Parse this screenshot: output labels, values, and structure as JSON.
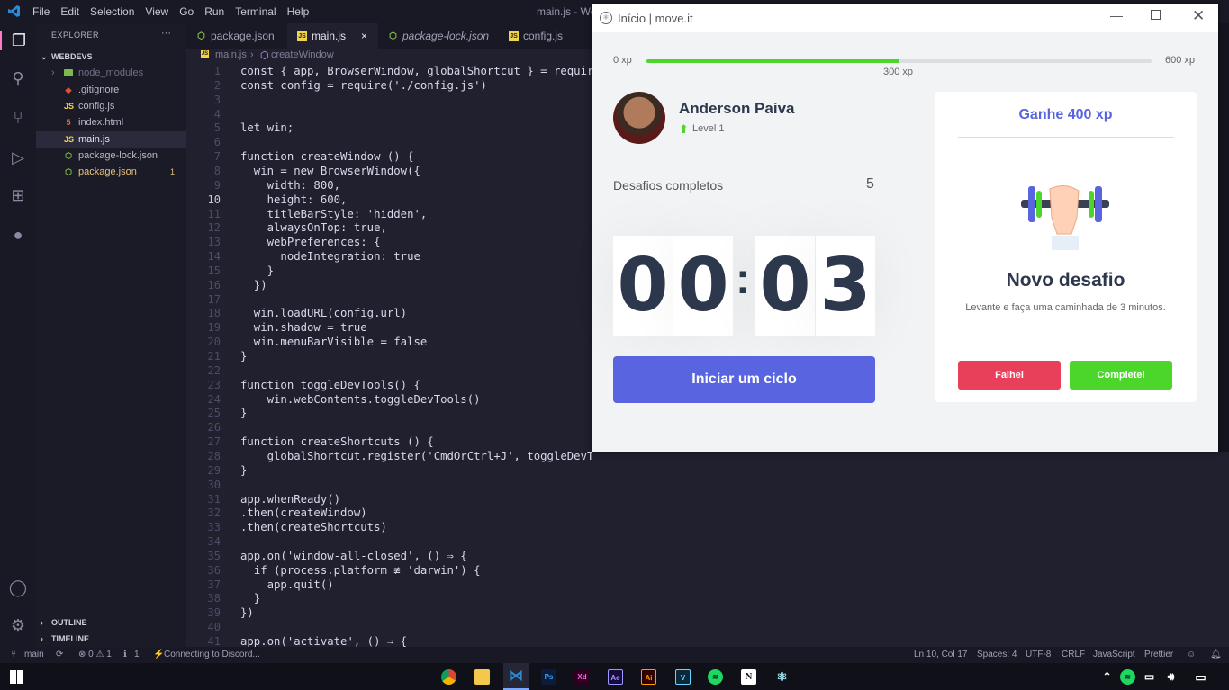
{
  "vscode": {
    "menu": [
      "File",
      "Edit",
      "Selection",
      "View",
      "Go",
      "Run",
      "Terminal",
      "Help"
    ],
    "window_title": "main.js - Web",
    "explorer_header": "EXPLORER",
    "explorer_more": "···",
    "project": "WEBDEVS",
    "files": [
      {
        "name": "node_modules",
        "kind": "folder"
      },
      {
        "name": ".gitignore",
        "kind": "git"
      },
      {
        "name": "config.js",
        "kind": "js"
      },
      {
        "name": "index.html",
        "kind": "html"
      },
      {
        "name": "main.js",
        "kind": "js"
      },
      {
        "name": "package-lock.json",
        "kind": "json"
      },
      {
        "name": "package.json",
        "kind": "json",
        "badge": "1"
      }
    ],
    "outline": "OUTLINE",
    "timeline": "TIMELINE",
    "tabs": [
      {
        "label": "package.json",
        "kind": "json"
      },
      {
        "label": "main.js",
        "kind": "js",
        "active": true,
        "close": "×"
      },
      {
        "label": "package-lock.json",
        "kind": "json"
      },
      {
        "label": "config.js",
        "kind": "js"
      }
    ],
    "breadcrumb": [
      "main.js",
      "createWindow"
    ],
    "status": {
      "branch": "main",
      "problems": "⊗ 0 ⚠ 1",
      "info": "1",
      "discord": "Connecting to Discord...",
      "position": "Ln 10, Col 17",
      "spaces": "Spaces: 4",
      "encoding": "UTF-8",
      "eol": "CRLF",
      "language": "JavaScript",
      "formatter": "Prettier"
    },
    "code": [
      {
        "n": "1",
        "t": "const { app, BrowserWindow, globalShortcut } = require('electron')"
      },
      {
        "n": "2",
        "t": "const config = require('./config.js')"
      },
      {
        "n": "3",
        "t": ""
      },
      {
        "n": "4",
        "t": ""
      },
      {
        "n": "5",
        "t": "let win;"
      },
      {
        "n": "6",
        "t": ""
      },
      {
        "n": "7",
        "t": "function createWindow () {"
      },
      {
        "n": "8",
        "t": "  win = new BrowserWindow({"
      },
      {
        "n": "9",
        "t": "    width: 800,"
      },
      {
        "n": "10",
        "t": "    height: 600,"
      },
      {
        "n": "11",
        "t": "    titleBarStyle: 'hidden',"
      },
      {
        "n": "12",
        "t": "    alwaysOnTop: true,"
      },
      {
        "n": "13",
        "t": "    webPreferences: {"
      },
      {
        "n": "14",
        "t": "      nodeIntegration: true"
      },
      {
        "n": "15",
        "t": "    }"
      },
      {
        "n": "16",
        "t": "  })"
      },
      {
        "n": "17",
        "t": ""
      },
      {
        "n": "18",
        "t": "  win.loadURL(config.url)"
      },
      {
        "n": "19",
        "t": "  win.shadow = true"
      },
      {
        "n": "20",
        "t": "  win.menuBarVisible = false"
      },
      {
        "n": "21",
        "t": "}"
      },
      {
        "n": "22",
        "t": ""
      },
      {
        "n": "23",
        "t": "function toggleDevTools() {"
      },
      {
        "n": "24",
        "t": "    win.webContents.toggleDevTools()"
      },
      {
        "n": "25",
        "t": "}"
      },
      {
        "n": "26",
        "t": ""
      },
      {
        "n": "27",
        "t": "function createShortcuts () {"
      },
      {
        "n": "28",
        "t": "    globalShortcut.register('CmdOrCtrl+J', toggleDevTools)"
      },
      {
        "n": "29",
        "t": "}"
      },
      {
        "n": "30",
        "t": ""
      },
      {
        "n": "31",
        "t": "app.whenReady()"
      },
      {
        "n": "32",
        "t": ".then(createWindow)"
      },
      {
        "n": "33",
        "t": ".then(createShortcuts)"
      },
      {
        "n": "34",
        "t": ""
      },
      {
        "n": "35",
        "t": "app.on('window-all-closed', () ⇒ {"
      },
      {
        "n": "36",
        "t": "  if (process.platform ≢ 'darwin') {"
      },
      {
        "n": "37",
        "t": "    app.quit()"
      },
      {
        "n": "38",
        "t": "  }"
      },
      {
        "n": "39",
        "t": "})"
      },
      {
        "n": "40",
        "t": ""
      },
      {
        "n": "41",
        "t": "app.on('activate', () ⇒ {"
      }
    ]
  },
  "moveit": {
    "window_title": "Início | move.it",
    "xp": {
      "min": "0 xp",
      "current": "300 xp",
      "max": "600 xp",
      "progress": 0.5
    },
    "profile": {
      "name": "Anderson Paiva",
      "level": "Level 1"
    },
    "challenges_label": "Desafios completos",
    "challenges_count": "5",
    "timer": {
      "m1": "0",
      "m2": "0",
      "sep": ":",
      "s1": "0",
      "s2": "3"
    },
    "start_button": "Iniciar um ciclo",
    "challenge": {
      "header": "Ganhe 400 xp",
      "title": "Novo desafio",
      "description": "Levante e faça uma caminhada de 3 minutos.",
      "fail": "Falhei",
      "complete": "Completei"
    },
    "colors": {
      "accent": "#5965e0",
      "green": "#4cd62b",
      "red": "#e83f5b",
      "text": "#2e384d"
    }
  },
  "taskbar": {
    "icons": [
      "chrome-icon",
      "files-icon",
      "vscode-icon",
      "photoshop-icon",
      "xd-icon",
      "after-effects-icon",
      "illustrator-icon",
      "vegas-icon",
      "spotify-icon",
      "notion-icon",
      "electron-icon"
    ]
  }
}
